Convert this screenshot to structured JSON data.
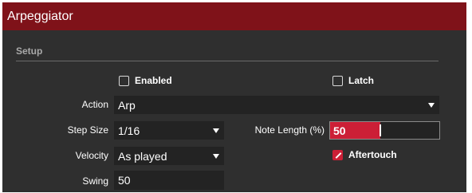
{
  "window": {
    "title": "Arpeggiator"
  },
  "setup": {
    "section_title": "Setup",
    "enabled": {
      "label": "Enabled",
      "checked": false
    },
    "latch": {
      "label": "Latch",
      "checked": false
    },
    "action": {
      "label": "Action",
      "value": "Arp"
    },
    "step_size": {
      "label": "Step Size",
      "value": "1/16"
    },
    "note_length": {
      "label": "Note Length (%)",
      "value": "50",
      "fill_fraction": 0.46
    },
    "velocity": {
      "label": "Velocity",
      "value": "As played"
    },
    "aftertouch": {
      "label": "Aftertouch",
      "checked": true
    },
    "swing": {
      "label": "Swing",
      "value": "50"
    }
  },
  "colors": {
    "title_bar": "#7f1219",
    "panel_bg": "#2f2f2f",
    "accent": "#cc1f36",
    "input_bg": "#232323"
  },
  "icons": {
    "dropdown": "chevron-down-icon",
    "checkbox": "checkbox-icon"
  }
}
